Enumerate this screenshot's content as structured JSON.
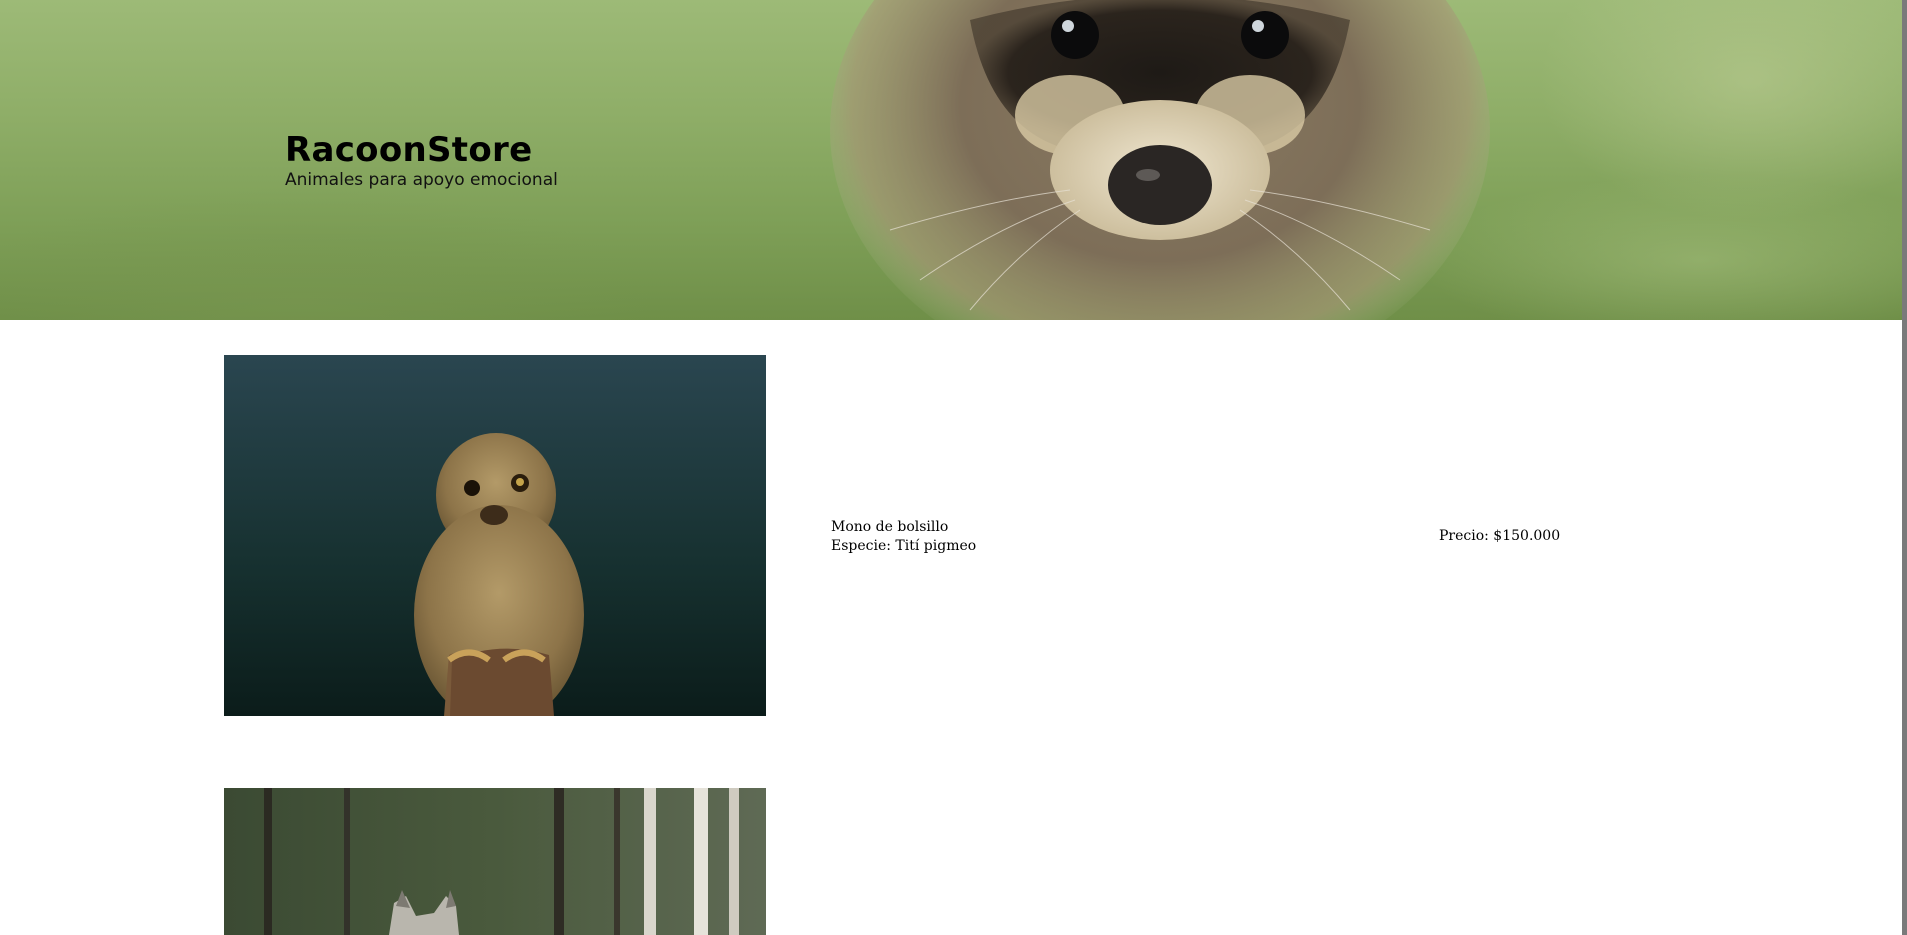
{
  "header": {
    "title": "RacoonStore",
    "subtitle": "Animales para apoyo emocional"
  },
  "products": [
    {
      "name": "Mono de bolsillo",
      "species": "Especie: Tití pigmeo",
      "price": "Precio: $150.000",
      "image_subject": "pygmy-marmoset"
    },
    {
      "name": "",
      "species": "",
      "price": "",
      "image_subject": "wolf-in-forest"
    }
  ]
}
